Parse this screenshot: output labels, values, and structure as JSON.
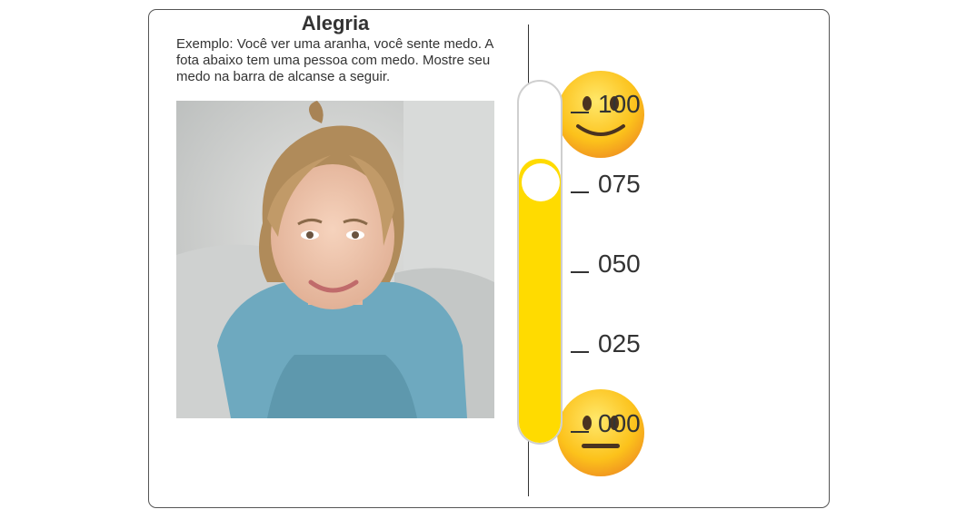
{
  "card": {
    "title": "Alegria",
    "description": "Exemplo: Você ver uma aranha, você sente medo. A fota abaixo tem uma pessoa com medo. Mostre seu medo na barra de alcanse a seguir."
  },
  "photo": {
    "icon": "photo-smiling-girl-blue-sweater"
  },
  "slider": {
    "value": 75,
    "min": 0,
    "max": 100,
    "fill_color": "#ffdb00",
    "ticks": [
      "100",
      "075",
      "050",
      "025",
      "000"
    ],
    "top_emoji": "smiling-face-icon",
    "bottom_emoji": "neutral-face-icon"
  }
}
